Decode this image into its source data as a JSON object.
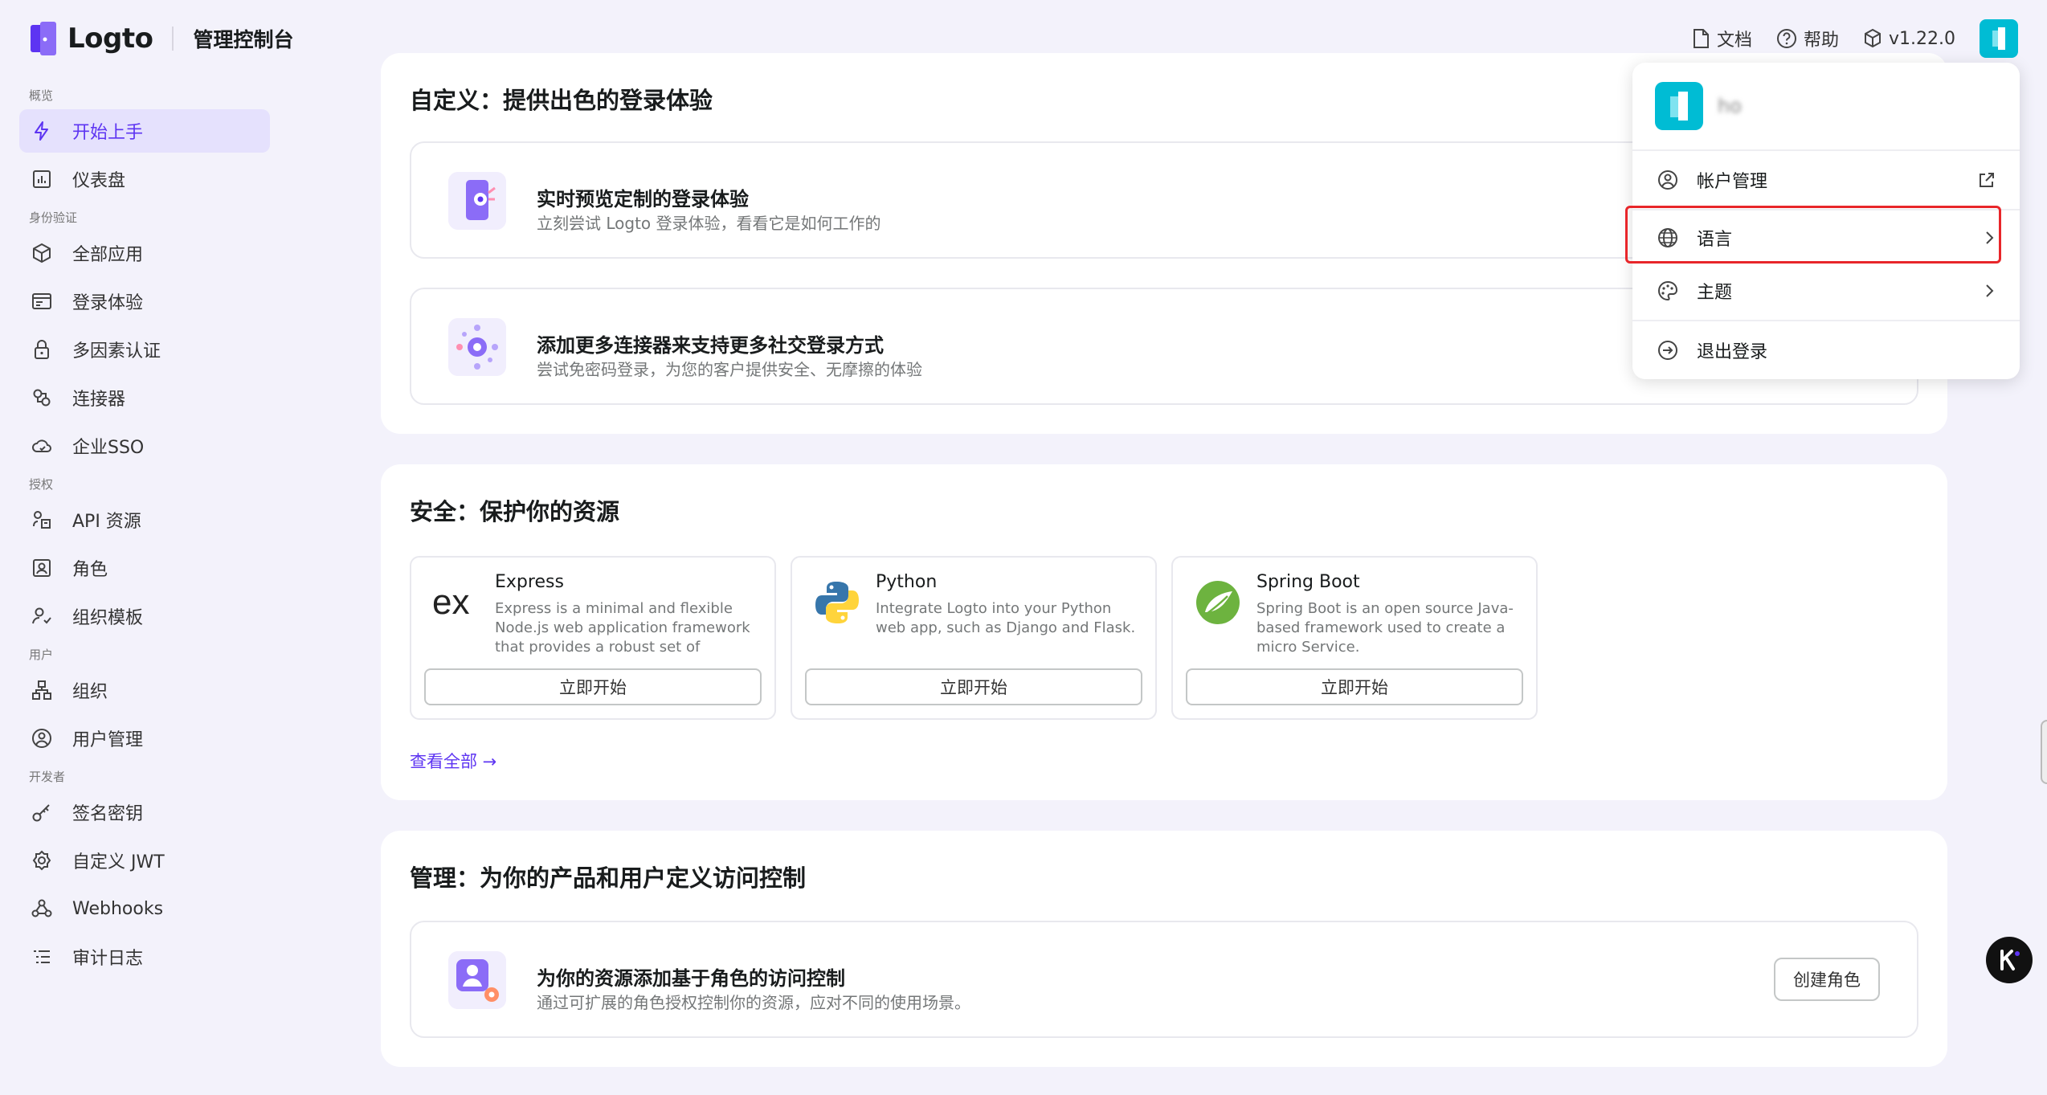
{
  "brand": {
    "name": "Logto",
    "subtitle": "管理控制台"
  },
  "topbar": {
    "docs": "文档",
    "help": "帮助",
    "version": "v1.22.0"
  },
  "sidebar": {
    "sections": [
      {
        "label": "概览",
        "items": [
          "开始上手",
          "仪表盘"
        ]
      },
      {
        "label": "身份验证",
        "items": [
          "全部应用",
          "登录体验",
          "多因素认证",
          "连接器",
          "企业SSO"
        ]
      },
      {
        "label": "授权",
        "items": [
          "API 资源",
          "角色",
          "组织模板"
        ]
      },
      {
        "label": "用户",
        "items": [
          "组织",
          "用户管理"
        ]
      },
      {
        "label": "开发者",
        "items": [
          "签名密钥",
          "自定义 JWT",
          "Webhooks",
          "审计日志"
        ]
      }
    ]
  },
  "customize": {
    "title": "自定义：提供出色的登录体验",
    "rows": [
      {
        "title": "实时预览定制的登录体验",
        "desc": "立刻尝试 Logto 登录体验，看看它是如何工作的"
      },
      {
        "title": "添加更多连接器来支持更多社交登录方式",
        "desc": "尝试免密码登录，为您的客户提供安全、无摩擦的体验"
      }
    ]
  },
  "security": {
    "title": "安全：保护你的资源",
    "samples": [
      {
        "name": "Express",
        "desc": "Express is a minimal and flexible Node.js web application framework that provides a robust set of features...",
        "button": "立即开始"
      },
      {
        "name": "Python",
        "desc": "Integrate Logto into your Python web app, such as Django and Flask.",
        "button": "立即开始"
      },
      {
        "name": "Spring Boot",
        "desc": "Spring Boot is an open source Java-based framework used to create a micro Service.",
        "button": "立即开始"
      }
    ],
    "view_all": "查看全部 →"
  },
  "manage": {
    "title": "管理：为你的产品和用户定义访问控制",
    "row": {
      "title": "为你的资源添加基于角色的访问控制",
      "desc": "通过可扩展的角色授权控制你的资源，应对不同的使用场景。",
      "button": "创建角色"
    }
  },
  "dropdown": {
    "username": "ho",
    "items": [
      "帐户管理",
      "语言",
      "主题",
      "退出登录"
    ]
  },
  "colors": {
    "accent": "#5d34f2",
    "highlight": "#e8262a",
    "avatar": "#00bcd4"
  }
}
